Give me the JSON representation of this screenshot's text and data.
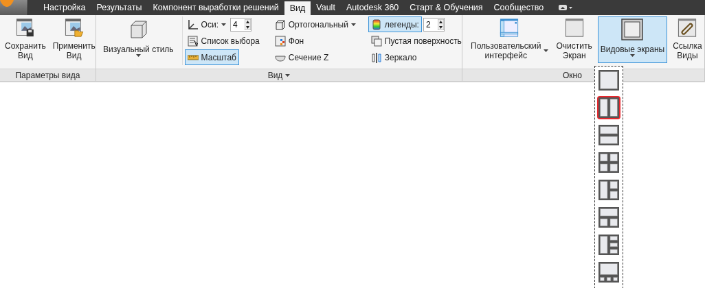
{
  "tabs": [
    {
      "label": "Настройка",
      "selected": false
    },
    {
      "label": "Результаты",
      "selected": false
    },
    {
      "label": "Компонент выработки решений",
      "selected": false
    },
    {
      "label": "Вид",
      "selected": true
    },
    {
      "label": "Vault",
      "selected": false
    },
    {
      "label": "Autodesk 360",
      "selected": false
    },
    {
      "label": "Старт & Обучения",
      "selected": false
    },
    {
      "label": "Сообщество",
      "selected": false
    }
  ],
  "panels": [
    {
      "title": "Параметры вида",
      "menu": false,
      "groups": [
        {
          "kind": "large",
          "label": [
            "Сохранить",
            "Вид"
          ],
          "menu": false,
          "active": false
        },
        {
          "kind": "large",
          "label": [
            "Применить",
            "Вид"
          ],
          "menu": false,
          "active": false
        }
      ]
    },
    {
      "title": "Вид",
      "menu": true,
      "groups": [
        {
          "kind": "large",
          "label": [
            "Визуальный стиль"
          ],
          "menu": true,
          "active": false
        },
        {
          "kind": "column",
          "items": [
            {
              "label": "Оси:",
              "menu": true,
              "spinner": "4",
              "active": false
            },
            {
              "label": "Список выбора",
              "menu": false,
              "active": false
            },
            {
              "label": "Масштаб",
              "menu": false,
              "active": true
            }
          ]
        },
        {
          "kind": "column",
          "items": [
            {
              "label": "Ортогональный",
              "menu": true,
              "active": false
            },
            {
              "label": "Фон",
              "menu": false,
              "active": false
            },
            {
              "label": "Сечение Z",
              "menu": false,
              "active": false
            }
          ]
        },
        {
          "kind": "column",
          "items": [
            {
              "label": "легенды:",
              "menu": false,
              "spinner": "2",
              "active": true
            },
            {
              "label": "Пустая поверхность",
              "menu": false,
              "active": false
            },
            {
              "label": "Зеркало",
              "menu": false,
              "active": false
            }
          ]
        }
      ]
    },
    {
      "title": "Окно",
      "menu": false,
      "groups": [
        {
          "kind": "large",
          "label": [
            "Пользовательский",
            "интерфейс"
          ],
          "menu": true,
          "active": false
        },
        {
          "kind": "large",
          "label": [
            "Очистить",
            "Экран"
          ],
          "menu": false,
          "active": false
        },
        {
          "kind": "large",
          "label": [
            "Видовые экраны"
          ],
          "menu": true,
          "active": true
        },
        {
          "kind": "large",
          "label": [
            "Ссылка",
            "Виды"
          ],
          "menu": false,
          "active": false
        }
      ]
    }
  ],
  "viewport_menu": {
    "items": [
      {
        "kind": "single",
        "selected": false
      },
      {
        "kind": "two-vertical",
        "selected": true
      },
      {
        "kind": "two-horizontal",
        "selected": false
      },
      {
        "kind": "four",
        "selected": false
      },
      {
        "kind": "left-two-right",
        "selected": false
      },
      {
        "kind": "top-two-bottom",
        "selected": false
      },
      {
        "kind": "left-three-right",
        "selected": false
      },
      {
        "kind": "top-three-bottom",
        "selected": false
      }
    ]
  }
}
